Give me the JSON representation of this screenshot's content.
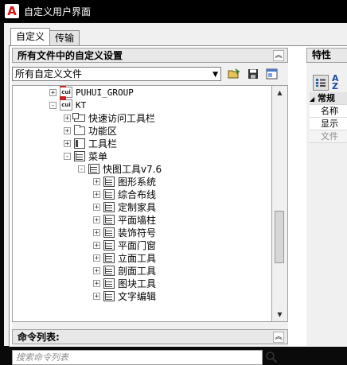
{
  "window": {
    "title": "自定义用户界面",
    "app_icon_letter": "A"
  },
  "tabs": [
    {
      "label": "自定义"
    },
    {
      "label": "传输"
    }
  ],
  "left_panel": {
    "header": "所有文件中的自定义设置",
    "selected_file": "所有自定义文件",
    "tree": [
      {
        "label": "PUHUI_GROUP",
        "icon": "cui-file-icon",
        "expander": "+"
      },
      {
        "label": "KT",
        "icon": "cui-file-icon",
        "expander": "-"
      },
      {
        "label": "快速访问工具栏",
        "icon": "quick-access-icon",
        "expander": "+"
      },
      {
        "label": "功能区",
        "icon": "ribbon-folder-icon",
        "expander": "+"
      },
      {
        "label": "工具栏",
        "icon": "toolbar-icon",
        "expander": "+"
      },
      {
        "label": "菜单",
        "icon": "menu-icon",
        "expander": "-"
      },
      {
        "label": "快图工具v7.6",
        "icon": "menu-icon",
        "expander": "-"
      },
      {
        "label": "图形系统",
        "icon": "menu-icon",
        "expander": "+"
      },
      {
        "label": "综合布线",
        "icon": "menu-icon",
        "expander": "+"
      },
      {
        "label": "定制家具",
        "icon": "menu-icon",
        "expander": "+"
      },
      {
        "label": "平面墙柱",
        "icon": "menu-icon",
        "expander": "+"
      },
      {
        "label": "装饰符号",
        "icon": "menu-icon",
        "expander": "+"
      },
      {
        "label": "平面门窗",
        "icon": "menu-icon",
        "expander": "+"
      },
      {
        "label": "立面工具",
        "icon": "menu-icon",
        "expander": "+"
      },
      {
        "label": "剖面工具",
        "icon": "menu-icon",
        "expander": "+"
      },
      {
        "label": "图块工具",
        "icon": "menu-icon",
        "expander": "+"
      },
      {
        "label": "文字编辑",
        "icon": "menu-icon",
        "expander": "+"
      }
    ]
  },
  "command_panel": {
    "header": "命令列表:",
    "search_placeholder": "搜索命令列表"
  },
  "properties_panel": {
    "header": "特性",
    "rows": [
      {
        "label": "常规",
        "kind": "category"
      },
      {
        "label": "名称",
        "kind": "key"
      },
      {
        "label": "显示",
        "kind": "key"
      },
      {
        "label": "文件",
        "kind": "key-grey"
      }
    ]
  },
  "colors": {
    "title_bar": "#000000",
    "app_icon": "#d11111",
    "panel_bg": "#f0f0f0"
  }
}
